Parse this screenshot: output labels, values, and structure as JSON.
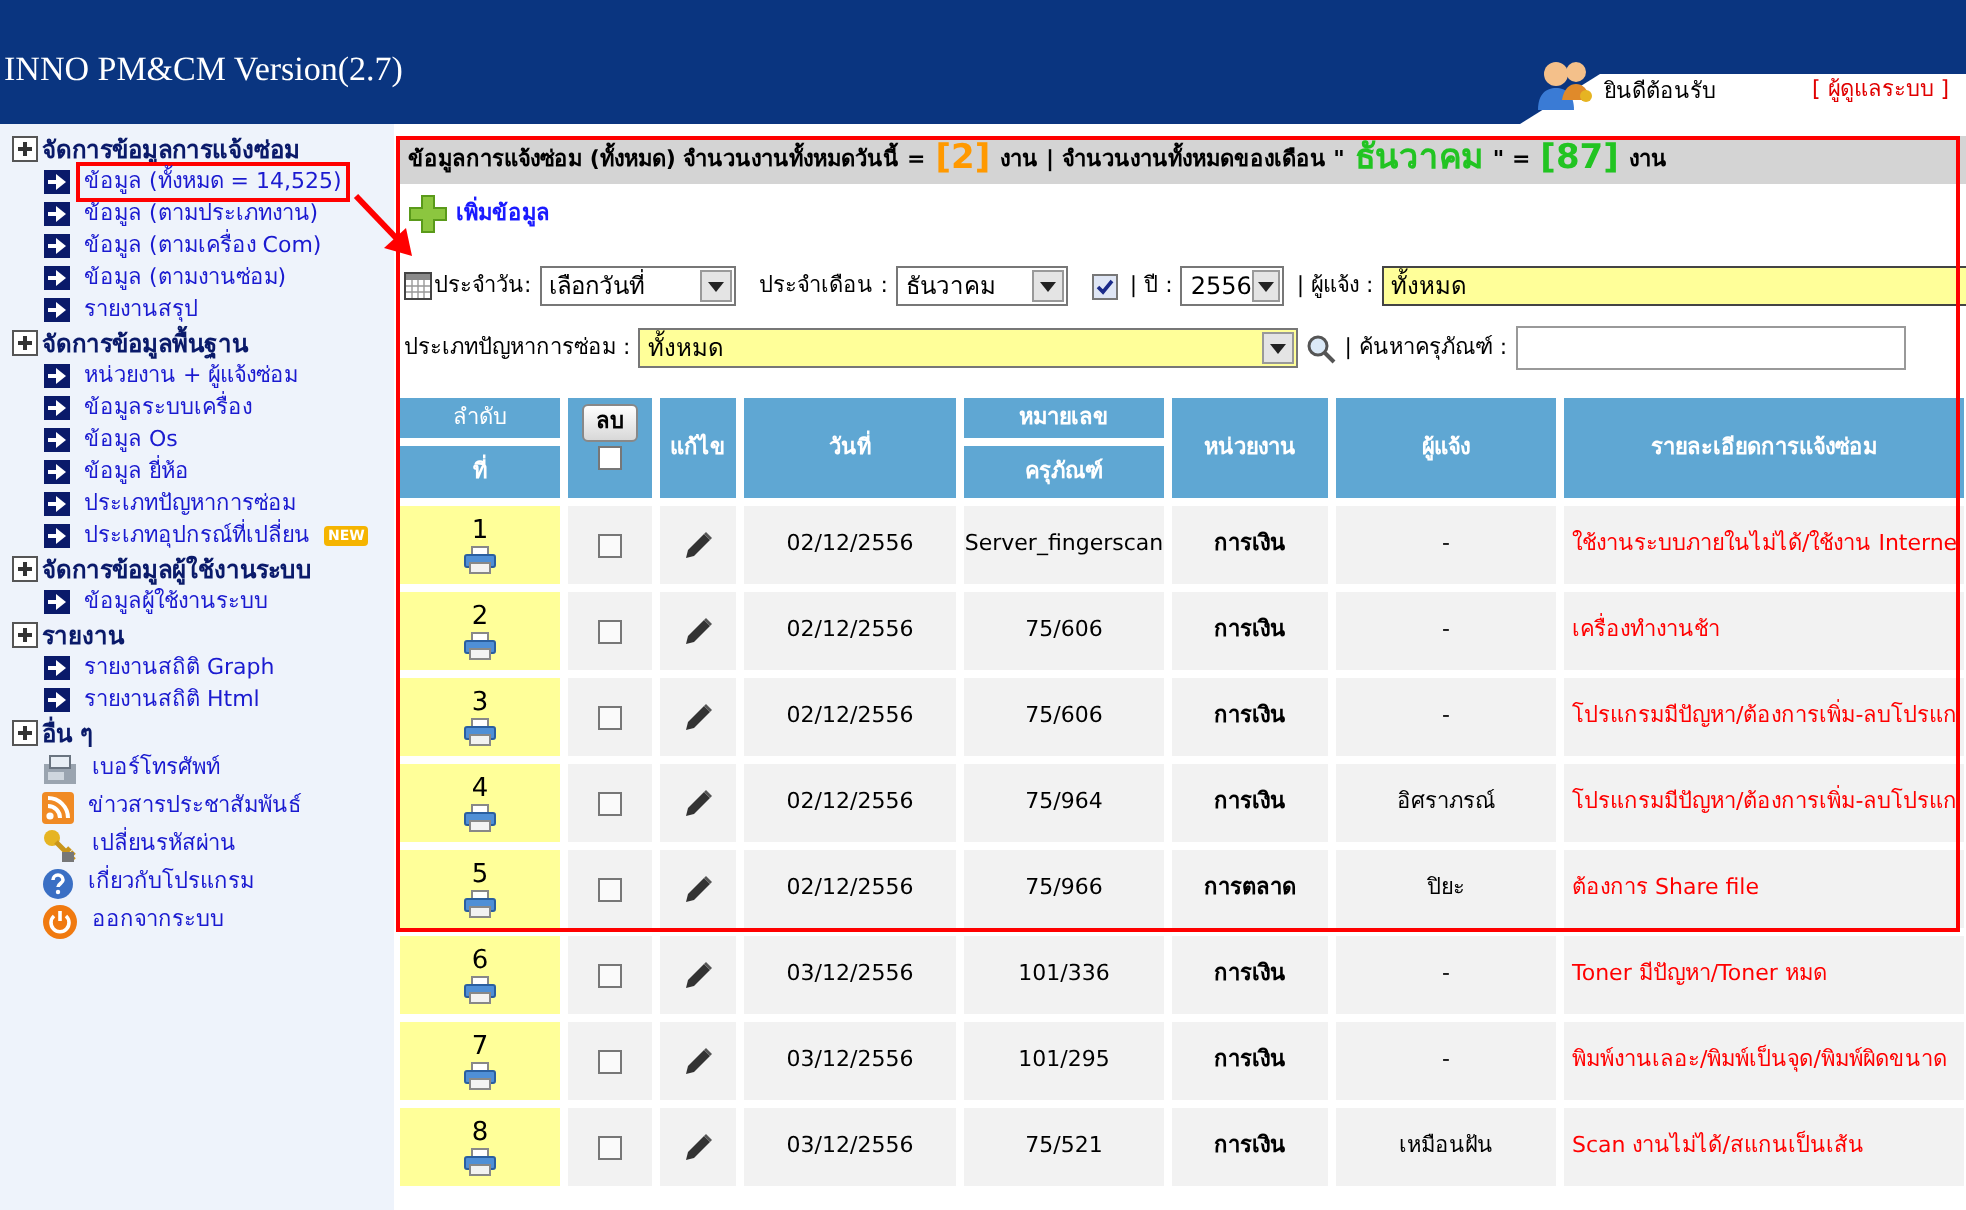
{
  "header": {
    "title": "INNO PM&CM Version(2.7)",
    "welcome": "ยินดีต้อนรับ",
    "user_role": "[ ผู้ดูแลระบบ ]"
  },
  "sidebar": {
    "sections": [
      {
        "label": "จัดการข้อมูลการแจ้งซ่อม",
        "items": [
          {
            "label": "ข้อมูล (ทั้งหมด = 14,525)",
            "kind": "arrow",
            "selected": true
          },
          {
            "label": "ข้อมูล (ตามประเภทงาน)",
            "kind": "arrow",
            "selected": false
          },
          {
            "label": "ข้อมูล (ตามเครื่อง Com)",
            "kind": "arrow",
            "selected": false
          },
          {
            "label": "ข้อมูล (ตามงานซ่อม)",
            "kind": "arrow",
            "selected": false
          },
          {
            "label": "รายงานสรุป",
            "kind": "arrow",
            "selected": false
          }
        ]
      },
      {
        "label": "จัดการข้อมูลพื้นฐาน",
        "items": [
          {
            "label": "หน่วยงาน + ผู้แจ้งซ่อม",
            "kind": "arrow",
            "selected": false
          },
          {
            "label": "ข้อมูลระบบเครื่อง",
            "kind": "arrow",
            "selected": false
          },
          {
            "label": "ข้อมูล Os",
            "kind": "arrow",
            "selected": false
          },
          {
            "label": "ข้อมูล ยี่ห้อ",
            "kind": "arrow",
            "selected": false
          },
          {
            "label": "ประเภทปัญหาการซ่อม",
            "kind": "arrow",
            "selected": false
          },
          {
            "label": "ประเภทอุปกรณ์ที่เปลี่ยน",
            "kind": "arrow",
            "selected": false,
            "badge": "NEW"
          }
        ]
      },
      {
        "label": "จัดการข้อมูลผู้ใช้งานระบบ",
        "items": [
          {
            "label": "ข้อมูลผู้ใช้งานระบบ",
            "kind": "arrow",
            "selected": false
          }
        ]
      },
      {
        "label": "รายงาน",
        "items": [
          {
            "label": "รายงานสถิติ Graph",
            "kind": "arrow",
            "selected": false
          },
          {
            "label": "รายงานสถิติ Html",
            "kind": "arrow",
            "selected": false
          }
        ]
      },
      {
        "label": "อื่น ๆ",
        "items": [
          {
            "label": "เบอร์โทรศัพท์",
            "kind": "phone",
            "selected": false
          },
          {
            "label": "ข่าวสารประชาสัมพันธ์",
            "kind": "rss",
            "selected": false
          },
          {
            "label": "เปลี่ยนรหัสผ่าน",
            "kind": "key",
            "selected": false
          },
          {
            "label": "เกี่ยวกับโปรแกรม",
            "kind": "help",
            "selected": false
          },
          {
            "label": "ออกจากระบบ",
            "kind": "power",
            "selected": false
          }
        ]
      }
    ]
  },
  "summary": [
    {
      "text": "ข้อมูลการแจ้งซ่อม (ทั้งหมด) จำนวนงานทั้งหมดวันนี้ =",
      "kind": "text"
    },
    {
      "text": "[2]",
      "kind": "today"
    },
    {
      "text": "งาน | จำนวนงานทั้งหมดของเดือน \"",
      "kind": "text"
    },
    {
      "text": "ธันวาคม",
      "kind": "month"
    },
    {
      "text": "\" =",
      "kind": "text"
    },
    {
      "text": "[87]",
      "kind": "month"
    },
    {
      "text": "งาน",
      "kind": "text"
    }
  ],
  "add_button": "เพิ่มข้อมูล",
  "filters": {
    "date_label": "ประจำวัน:",
    "date_select": "เลือกวันที่",
    "month_label": "ประจำเดือน :",
    "month_select": "ธันวาคม",
    "month_checked": true,
    "year_label": "| ปี :",
    "year_select": "2556",
    "reporter_label": "| ผู้แจ้ง :",
    "reporter_select": "ทั้งหมด",
    "type_label": "ประเภทปัญหาการซ่อม :",
    "type_select": "ทั้งหมด",
    "search_label": "| ค้นหาครุภัณฑ์ :"
  },
  "table": {
    "columns": {
      "no_top": "ลำดับ",
      "no_bottom": "ที่",
      "delete_button": "ลบ",
      "select_all_checked": false,
      "edit": "แก้ไข",
      "date": "วันที่",
      "asset_top": "หมายเลข",
      "asset_bottom": "ครุภัณฑ์",
      "unit": "หน่วยงาน",
      "reporter": "ผู้แจ้ง",
      "detail": "รายละเอียดการแจ้งซ่อม"
    },
    "rows": [
      {
        "no": "1",
        "checked": false,
        "date": "02/12/2556",
        "asset": "Server_fingerscan",
        "unit": "การเงิน",
        "reporter": "-",
        "detail": "ใช้งานระบบภายในไม่ได้/ใช้งาน Interne"
      },
      {
        "no": "2",
        "checked": false,
        "date": "02/12/2556",
        "asset": "75/606",
        "unit": "การเงิน",
        "reporter": "-",
        "detail": "เครื่องทำงานช้า"
      },
      {
        "no": "3",
        "checked": false,
        "date": "02/12/2556",
        "asset": "75/606",
        "unit": "การเงิน",
        "reporter": "-",
        "detail": "โปรแกรมมีปัญหา/ต้องการเพิ่ม-ลบโปรแก"
      },
      {
        "no": "4",
        "checked": false,
        "date": "02/12/2556",
        "asset": "75/964",
        "unit": "การเงิน",
        "reporter": "อิศราภรณ์",
        "detail": "โปรแกรมมีปัญหา/ต้องการเพิ่ม-ลบโปรแก"
      },
      {
        "no": "5",
        "checked": false,
        "date": "02/12/2556",
        "asset": "75/966",
        "unit": "การตลาด",
        "reporter": "ปิยะ",
        "detail": "ต้องการ Share file"
      },
      {
        "no": "6",
        "checked": false,
        "date": "03/12/2556",
        "asset": "101/336",
        "unit": "การเงิน",
        "reporter": "-",
        "detail": "Toner มีปัญหา/Toner หมด"
      },
      {
        "no": "7",
        "checked": false,
        "date": "03/12/2556",
        "asset": "101/295",
        "unit": "การเงิน",
        "reporter": "-",
        "detail": "พิมพ์งานเลอะ/พิมพ์เป็นจุด/พิมพ์ผิดขนาด"
      },
      {
        "no": "8",
        "checked": false,
        "date": "03/12/2556",
        "asset": "75/521",
        "unit": "การเงิน",
        "reporter": "เหมือนฝัน",
        "detail": "Scan งานไม่ได้/สแกนเป็นเส้น"
      }
    ]
  }
}
